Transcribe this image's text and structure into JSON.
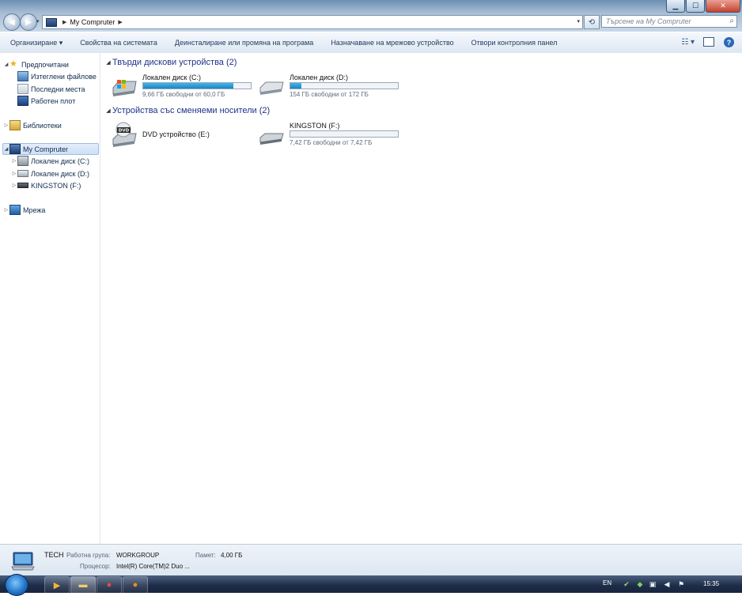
{
  "window": {
    "address": {
      "location": "My Compruter"
    },
    "search_placeholder": "Търсене на My Compruter",
    "controls": {
      "minimize": "▁",
      "maximize": "☐",
      "close": "✕"
    }
  },
  "commandbar": {
    "organize": "Организиране ▾",
    "system_properties": "Свойства на системата",
    "uninstall": "Деинсталиране или промяна на програма",
    "map_drive": "Назначаване на мрежово устройство",
    "control_panel": "Отвори контролния панел"
  },
  "navpane": {
    "favorites": "Предпочитани",
    "downloads": "Изтеглени файлове",
    "recent": "Последни места",
    "desktop": "Работен плот",
    "libraries": "Библиотеки",
    "computer": "My Compruter",
    "drive_c": "Локален диск (C:)",
    "drive_d": "Локален диск (D:)",
    "drive_f": "KINGSTON (F:)",
    "network": "Мрежа"
  },
  "content": {
    "hdd_group": "Твърди дискови устройства (2)",
    "removable_group": "Устройства със сменяеми носители (2)",
    "drives": [
      {
        "name": "Локален диск (C:)",
        "free": "9,66 ГБ свободни от 60,0 ГБ",
        "used_fraction": 0.84
      },
      {
        "name": "Локален диск (D:)",
        "free": "154 ГБ свободни от 172 ГБ",
        "used_fraction": 0.1
      },
      {
        "name": "DVD устройство (E:)"
      },
      {
        "name": "KINGSTON (F:)",
        "free": "7,42 ГБ свободни от 7,42 ГБ",
        "used_fraction": 0.0
      }
    ]
  },
  "details": {
    "computer_name": "TECH",
    "workgroup_label": "Работна група:",
    "workgroup_value": "WORKGROUP",
    "memory_label": "Памет:",
    "memory_value": "4,00 ГБ",
    "cpu_label": "Процесор:",
    "cpu_value": "Intel(R) Core(TM)2 Duo ..."
  },
  "taskbar": {
    "language": "EN",
    "clock": "15:35"
  }
}
